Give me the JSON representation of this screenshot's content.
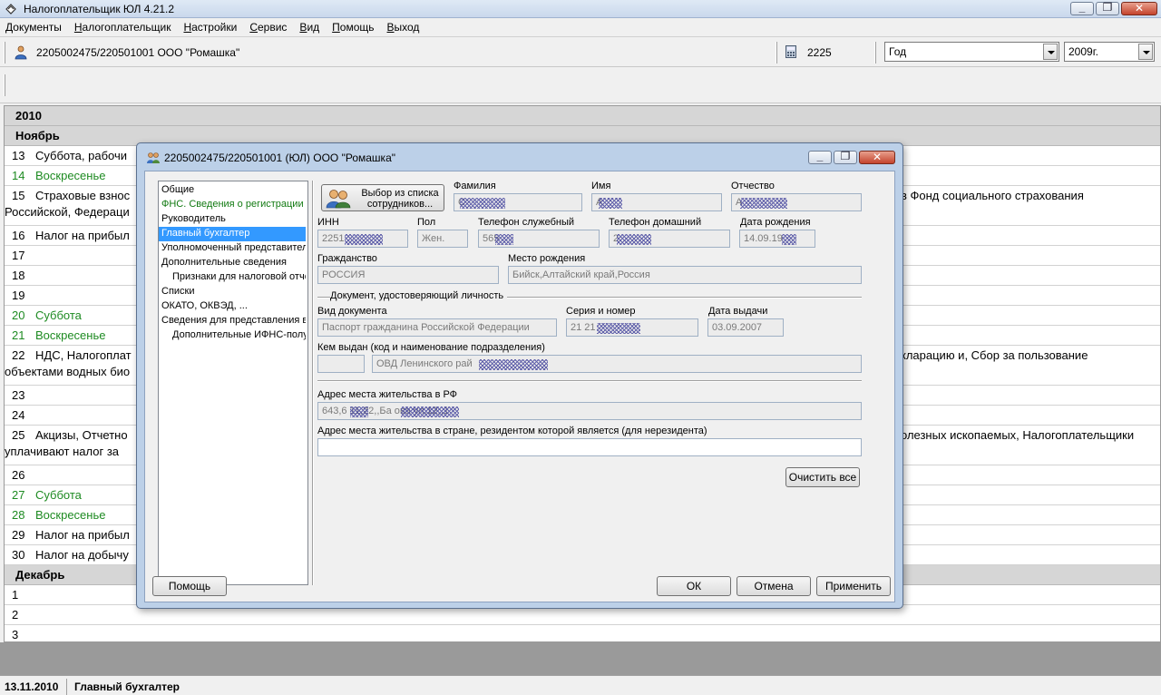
{
  "app": {
    "title": "Налогоплательщик ЮЛ 4.21.2"
  },
  "menu": [
    "Документы",
    "Налогоплательщик",
    "Настройки",
    "Сервис",
    "Вид",
    "Помощь",
    "Выход"
  ],
  "toolbar": {
    "organization": "2205002475/220501001 ООО \"Ромашка\"",
    "code": "2225",
    "period_type": "Год",
    "period_year": "2009г."
  },
  "calendar": {
    "year": "2010",
    "rows": [
      {
        "kind": "head",
        "text": "Ноябрь"
      },
      {
        "kind": "day",
        "num": "13",
        "text": "Суббота, рабочи"
      },
      {
        "kind": "green",
        "num": "14",
        "text": "Воскресенье"
      },
      {
        "kind": "day",
        "num": "15",
        "text": "Страховые взнос",
        "right": "в Фонд социального страхования",
        "line2": "Российской, Федераци"
      },
      {
        "kind": "day",
        "num": "16",
        "text": "Налог на прибыл"
      },
      {
        "kind": "day",
        "num": "17",
        "text": ""
      },
      {
        "kind": "day",
        "num": "18",
        "text": ""
      },
      {
        "kind": "day",
        "num": "19",
        "text": ""
      },
      {
        "kind": "green",
        "num": "20",
        "text": "Суббота"
      },
      {
        "kind": "green",
        "num": "21",
        "text": "Воскресенье"
      },
      {
        "kind": "day",
        "num": "22",
        "text": "НДС, Налогоплат",
        "right": "кларацию и, Сбор за пользование",
        "line2": "объектами водных био"
      },
      {
        "kind": "day",
        "num": "23",
        "text": ""
      },
      {
        "kind": "day",
        "num": "24",
        "text": ""
      },
      {
        "kind": "day",
        "num": "25",
        "text": "Акцизы, Отчетно",
        "right": "олезных ископаемых, Налогоплательщики",
        "line2": "уплачивают налог за"
      },
      {
        "kind": "day",
        "num": "26",
        "text": ""
      },
      {
        "kind": "green",
        "num": "27",
        "text": "Суббота"
      },
      {
        "kind": "green",
        "num": "28",
        "text": "Воскресенье"
      },
      {
        "kind": "day",
        "num": "29",
        "text": "Налог на прибыл"
      },
      {
        "kind": "day",
        "num": "30",
        "text": "Налог на добычу"
      },
      {
        "kind": "head",
        "text": "Декабрь"
      },
      {
        "kind": "day",
        "num": "1",
        "text": ""
      },
      {
        "kind": "day",
        "num": "2",
        "text": ""
      },
      {
        "kind": "day",
        "num": "3",
        "text": ""
      }
    ]
  },
  "dialog": {
    "title": "2205002475/220501001 (ЮЛ) ООО \"Ромашка\"",
    "nav": [
      {
        "label": "Общие",
        "style": "normal"
      },
      {
        "label": "ФНС. Сведения о регистрации",
        "style": "green"
      },
      {
        "label": "Руководитель",
        "style": "normal"
      },
      {
        "label": "Главный бухгалтер",
        "style": "selected"
      },
      {
        "label": "Уполномоченный представитель",
        "style": "normal"
      },
      {
        "label": "Дополнительные сведения",
        "style": "normal"
      },
      {
        "label": "Признаки для налоговой отчетности",
        "style": "indent"
      },
      {
        "label": "Списки",
        "style": "normal"
      },
      {
        "label": "ОКАТО, ОКВЭД, ...",
        "style": "normal"
      },
      {
        "label": "Сведения для представления в",
        "style": "normal"
      },
      {
        "label": "Дополнительные ИФНС-получатели",
        "style": "indent"
      }
    ],
    "pick_button": "Выбор из списка сотрудников...",
    "labels": {
      "surname": "Фамилия",
      "name": "Имя",
      "patronymic": "Отчество",
      "inn": "ИНН",
      "gender": "Пол",
      "work_phone": "Телефон служебный",
      "home_phone": "Телефон домашний",
      "birth_date": "Дата рождения",
      "citizenship": "Гражданство",
      "birth_place": "Место рождения",
      "id_group": "Документ, удостоверяющий личность",
      "doc_type": "Вид документа",
      "series_number": "Серия и номер",
      "issue_date": "Дата выдачи",
      "issued_by": "Кем выдан (код и наименование подразделения)",
      "address_rf": "Адрес места жительства в РФ",
      "address_foreign": "Адрес места жительства в стране, резидентом которой является (для нерезидента)"
    },
    "values": {
      "surname": "С",
      "name": "А",
      "patronymic": "А",
      "inn": "2251",
      "gender": "Жен.",
      "work_phone": "565",
      "home_phone": "2",
      "birth_date": "14.09.19",
      "citizenship": "РОССИЯ",
      "birth_place": "Бийск,Алтайский край,Россия",
      "doc_type": "Паспорт гражданина Российской Федерации",
      "series_number": "21 21",
      "issue_date": "03.09.2007",
      "issued_by_code": "",
      "issued_by": "ОВД Ленинского рай",
      "address_rf": "643,6 11,22,,Ба ова ул,12,,1",
      "address_foreign": ""
    },
    "buttons": {
      "clear_all": "Очистить все",
      "help": "Помощь",
      "ok": "ОК",
      "cancel": "Отмена",
      "apply": "Применить"
    }
  },
  "status": {
    "date": "13.11.2010",
    "role": "Главный бухгалтер"
  }
}
